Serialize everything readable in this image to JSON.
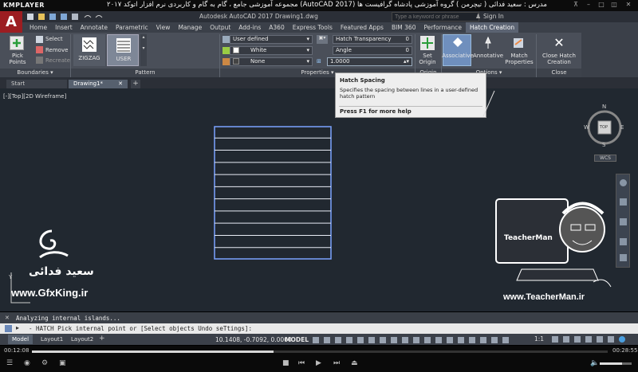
{
  "player": {
    "logo": "KMPLAYER",
    "caption": "مجموعه آموزشی جامع ، گام به گام و کاربردی نرم افزار  اتوکد ۲۰۱۷ (AutoCAD 2017)  مدرس : سعید فدائی ( تیچرمن ) گروه آموزشی پادشاه گرافیست ها",
    "time_current": "00:12:08",
    "time_total": "00:28:55",
    "progress": 0.42
  },
  "app": {
    "logo": "A",
    "file_title": "Autodesk AutoCAD 2017    Drawing1.dwg",
    "search_placeholder": "Type a keyword or phrase",
    "sign_in": "Sign In"
  },
  "ribbon_tabs": [
    "Home",
    "Insert",
    "Annotate",
    "Parametric",
    "View",
    "Manage",
    "Output",
    "Add-ins",
    "A360",
    "Express Tools",
    "Featured Apps",
    "BIM 360",
    "Performance",
    "Hatch Creation"
  ],
  "ribbon": {
    "boundaries": {
      "pick_points": "Pick Points",
      "select": "Select",
      "remove": "Remove",
      "recreate": "Recreate",
      "title": "Boundaries"
    },
    "pattern": {
      "zigzag": "ZIGZAG",
      "user": "USER",
      "title": "Pattern"
    },
    "properties": {
      "type": "User defined",
      "color": "White",
      "background": "None",
      "transparency_label": "Hatch Transparency",
      "transparency_value": "0",
      "angle_label": "Angle",
      "angle_value": "0",
      "spacing_value": "1.0000",
      "title": "Properties"
    },
    "origin": {
      "set_origin": "Set Origin",
      "title": "Origin"
    },
    "options": {
      "associative": "Associative",
      "annotative": "Annotative",
      "match": "Match Properties",
      "title": "Options"
    },
    "close": {
      "label": "Close Hatch Creation",
      "title": "Close"
    }
  },
  "file_tabs": [
    "Start",
    "Drawing1*"
  ],
  "viewport_label": "[-][Top][2D Wireframe]",
  "tooltip": {
    "title": "Hatch Spacing",
    "body": "Specifies the spacing between lines in a user-defined hatch pattern",
    "help": "Press F1 for more help"
  },
  "viewcube": {
    "n": "N",
    "s": "S",
    "e": "E",
    "w": "W",
    "top": "TOP",
    "wcs": "WCS"
  },
  "command": {
    "history": "Analyzing internal islands...",
    "prompt": "- HATCH Pick internal point or [Select objects Undo seTtings]:"
  },
  "layout_tabs": [
    "Model",
    "Layout1",
    "Layout2"
  ],
  "status": {
    "coords": "10.1408, -0.7092, 0.0000",
    "model": "MODEL",
    "scale": "1:1"
  },
  "watermarks": {
    "gfx": "www.GfxKing.ir",
    "teacher": "www.TeacherMan.ir",
    "name": "سعید فدائی",
    "logo_text": "TeacherMan"
  },
  "hatch": {
    "lines": 10
  }
}
